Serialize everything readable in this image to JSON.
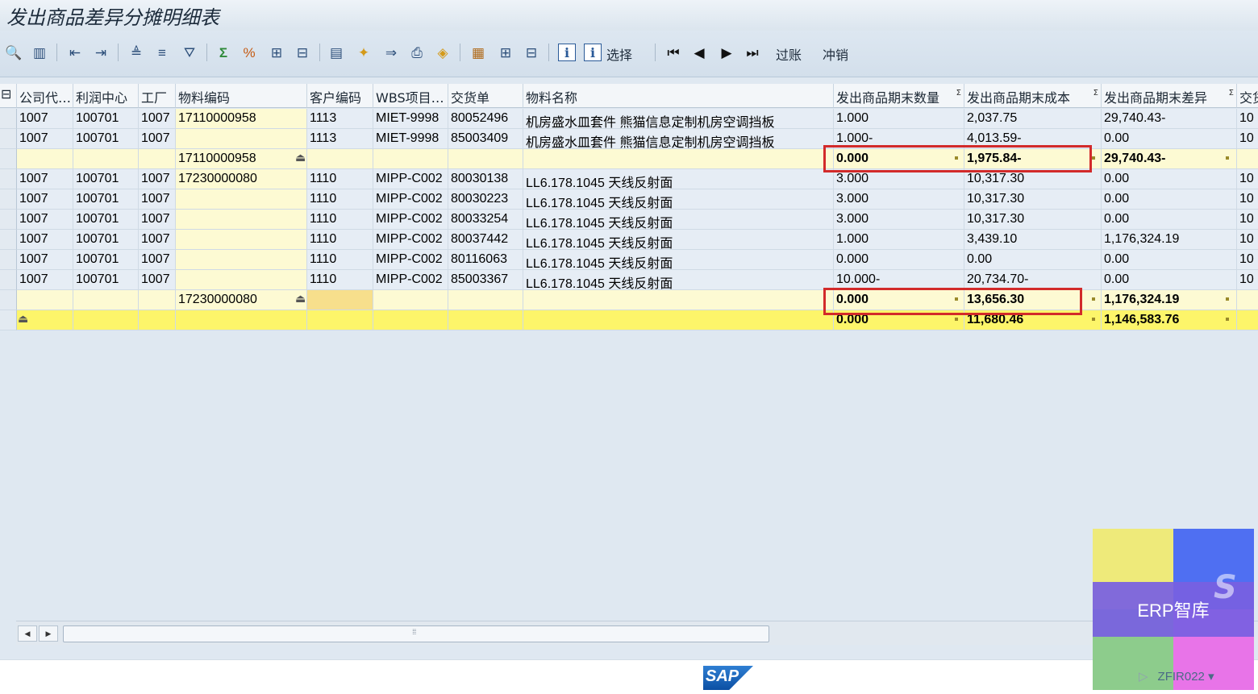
{
  "window": {
    "title": "发出商品差异分摊明细表"
  },
  "toolbar": {
    "select_label": "选择",
    "post_label": "过账",
    "reverse_label": "冲销",
    "icons": [
      "detail-icon",
      "column-layout-icon",
      "export-left-icon",
      "export-right-icon",
      "sort-ascending-icon",
      "sort-descending-icon",
      "filter-icon",
      "sum-icon",
      "subtotal-icon",
      "add-row-icon",
      "delete-row-icon",
      "spreadsheet-export-icon",
      "find-icon",
      "find-next-icon",
      "print-icon",
      "graphic-icon",
      "layout-select-icon",
      "layout-change-icon",
      "layout-save-icon",
      "info-icon",
      "info-select-icon",
      "first-page-icon",
      "previous-page-icon",
      "next-page-icon",
      "last-page-icon"
    ]
  },
  "grid": {
    "columns": [
      "公司代…",
      "利润中心",
      "工厂",
      "物料编码",
      "客户编码",
      "WBS项目…",
      "交货单",
      "物料名称",
      "发出商品期末数量",
      "发出商品期末成本",
      "发出商品期末差异",
      "交货"
    ],
    "rows": [
      {
        "type": "data",
        "company": "1007",
        "profit_center": "100701",
        "plant": "1007",
        "material": "17110000958",
        "customer": "1113",
        "wbs": "MIET-9998",
        "delivery": "80052496",
        "name": "机房盛水皿套件 熊猫信息定制机房空调挡板",
        "qty": "1.000",
        "cost": "2,037.75",
        "variance": "29,740.43-",
        "extra": "10"
      },
      {
        "type": "data",
        "company": "1007",
        "profit_center": "100701",
        "plant": "1007",
        "material": "",
        "customer": "1113",
        "wbs": "MIET-9998",
        "delivery": "85003409",
        "name": "机房盛水皿套件 熊猫信息定制机房空调挡板",
        "qty": "1.000-",
        "cost": "4,013.59-",
        "variance": "0.00",
        "extra": "10"
      },
      {
        "type": "subtotal",
        "material": "17110000958",
        "qty": "0.000",
        "cost": "1,975.84-",
        "variance": "29,740.43-"
      },
      {
        "type": "data",
        "company": "1007",
        "profit_center": "100701",
        "plant": "1007",
        "material": "17230000080",
        "customer": "1110",
        "wbs": "MIPP-C002",
        "delivery": "80030138",
        "name": "LL6.178.1045 天线反射面",
        "qty": "3.000",
        "cost": "10,317.30",
        "variance": "0.00",
        "extra": "10"
      },
      {
        "type": "data",
        "company": "1007",
        "profit_center": "100701",
        "plant": "1007",
        "material": "",
        "customer": "1110",
        "wbs": "MIPP-C002",
        "delivery": "80030223",
        "name": "LL6.178.1045 天线反射面",
        "qty": "3.000",
        "cost": "10,317.30",
        "variance": "0.00",
        "extra": "10"
      },
      {
        "type": "data",
        "company": "1007",
        "profit_center": "100701",
        "plant": "1007",
        "material": "",
        "customer": "1110",
        "wbs": "MIPP-C002",
        "delivery": "80033254",
        "name": "LL6.178.1045 天线反射面",
        "qty": "3.000",
        "cost": "10,317.30",
        "variance": "0.00",
        "extra": "10"
      },
      {
        "type": "data",
        "company": "1007",
        "profit_center": "100701",
        "plant": "1007",
        "material": "",
        "customer": "1110",
        "wbs": "MIPP-C002",
        "delivery": "80037442",
        "name": "LL6.178.1045 天线反射面",
        "qty": "1.000",
        "cost": "3,439.10",
        "variance": "1,176,324.19",
        "extra": "10"
      },
      {
        "type": "data",
        "company": "1007",
        "profit_center": "100701",
        "plant": "1007",
        "material": "",
        "customer": "1110",
        "wbs": "MIPP-C002",
        "delivery": "80116063",
        "name": "LL6.178.1045 天线反射面",
        "qty": "0.000",
        "cost": "0.00",
        "variance": "0.00",
        "extra": "10"
      },
      {
        "type": "data",
        "company": "1007",
        "profit_center": "100701",
        "plant": "1007",
        "material": "",
        "customer": "1110",
        "wbs": "MIPP-C002",
        "delivery": "85003367",
        "name": "LL6.178.1045 天线反射面",
        "qty": "10.000-",
        "cost": "20,734.70-",
        "variance": "0.00",
        "extra": "10"
      },
      {
        "type": "subtotal",
        "material": "17230000080",
        "qty": "0.000",
        "cost": "13,656.30",
        "variance": "1,176,324.19"
      },
      {
        "type": "total",
        "qty": "0.000",
        "cost": "11,680.46",
        "variance": "1,146,583.76"
      }
    ]
  },
  "watermark": {
    "text": "ERP智库"
  },
  "statusbar": {
    "logo": "SAP",
    "tcode": "ZFIR022"
  }
}
